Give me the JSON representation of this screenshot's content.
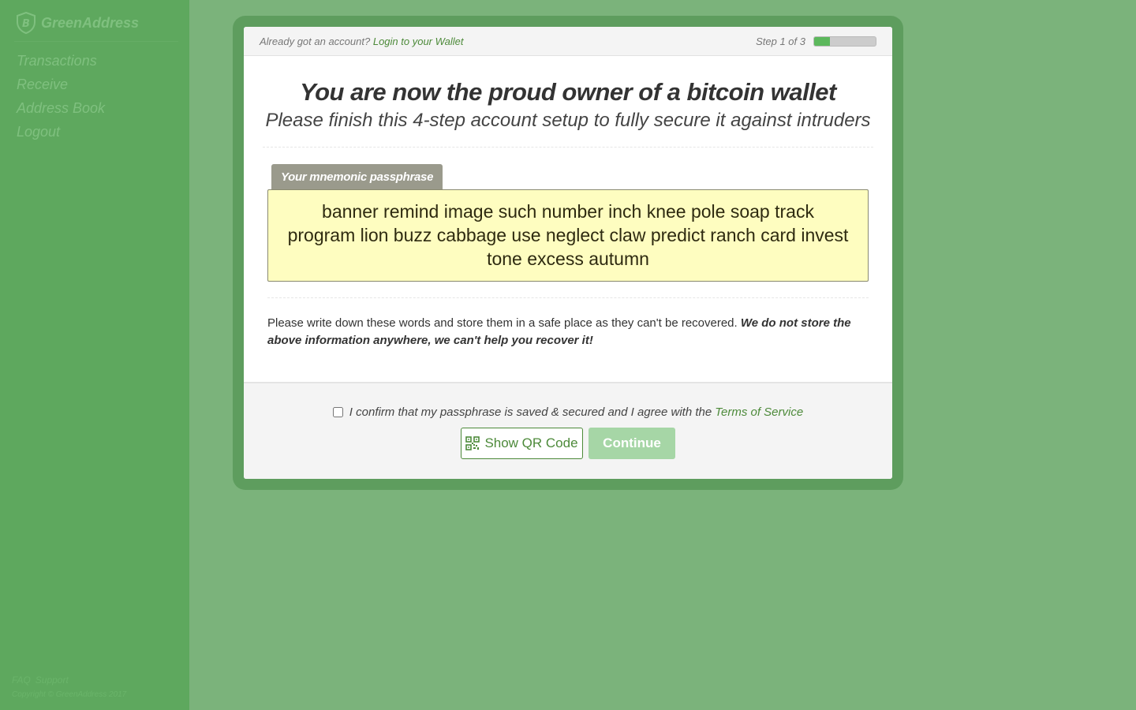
{
  "sidebar": {
    "brand_name": "GreenAddress",
    "brand_icon": "shield-bitcoin-icon",
    "items": [
      {
        "label": "Transactions"
      },
      {
        "label": "Receive"
      },
      {
        "label": "Address Book"
      },
      {
        "label": "Logout"
      }
    ],
    "footer": {
      "faq_label": "FAQ",
      "support_label": "Support",
      "copyright": "Copyright © GreenAddress 2017"
    }
  },
  "modal": {
    "top_bar": {
      "account_prompt": "Already got an account?",
      "login_link": "Login to your Wallet",
      "step_text": "Step 1 of 3",
      "progress_fraction": 0.25
    },
    "headline": "You are now the proud owner of a bitcoin wallet",
    "subheadline": "Please finish this 4-step account setup to fully secure it against intruders",
    "passphrase": {
      "tab_label": "Your mnemonic passphrase",
      "line1": "banner remind image such number inch knee pole soap track",
      "line2": "program lion buzz cabbage use neglect claw predict ranch card invest",
      "line3": "tone excess autumn"
    },
    "notice": {
      "plain": "Please write down these words and store them in a safe place as they can't be recovered.",
      "bold": "We do not store the above information anywhere, we can't help you recover it!"
    },
    "footer": {
      "confirm_text": "I confirm that my passphrase is saved & secured and I agree with the",
      "terms_link": "Terms of Service",
      "checkbox_checked": false,
      "qr_button_label": "Show QR Code",
      "qr_icon": "qr-code-icon",
      "continue_label": "Continue"
    }
  },
  "colors": {
    "background": "#7bb37b",
    "sidebar": "#5ea85e",
    "accent_green": "#4d8a3a",
    "passphrase_bg": "#fefdc0",
    "continue_disabled": "#a6d6a6"
  }
}
